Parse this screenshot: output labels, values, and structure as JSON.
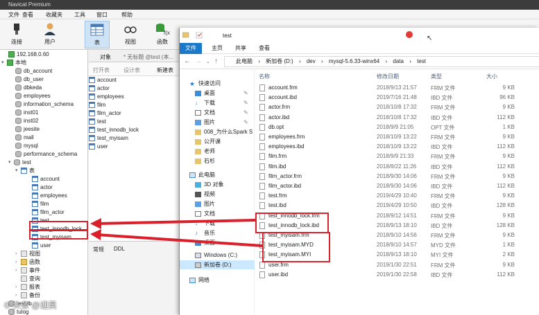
{
  "navicat": {
    "title": "Navicat Premium",
    "menu": [
      "文件",
      "查看",
      "收藏夹",
      "工具",
      "窗口",
      "帮助"
    ],
    "toolbar": [
      {
        "label": "连接",
        "icon": "plug-icon"
      },
      {
        "label": "用户",
        "icon": "user-icon"
      },
      {
        "label": "表",
        "icon": "table-icon"
      },
      {
        "label": "视图",
        "icon": "view-icon"
      },
      {
        "label": "函数",
        "icon": "function-icon"
      }
    ],
    "tree": {
      "server": "192.168.0.60",
      "local": "本地",
      "databases": [
        "db_account",
        "db_user",
        "dbkeda",
        "employees",
        "information_schema",
        "inst01",
        "inst02",
        "jeesite",
        "mall",
        "mysql",
        "performance_schema"
      ],
      "test_db": "test",
      "tables_node": "表",
      "tables": [
        "account",
        "actor",
        "employees",
        "film",
        "film_actor",
        "test",
        "test_innodb_lock",
        "test_myisam",
        "user"
      ],
      "other_nodes": [
        "视图",
        "函数",
        "事件",
        "查询",
        "报表",
        "备份"
      ],
      "after": [
        "testdb",
        "tulog"
      ]
    },
    "middle": {
      "tab_object": "对象",
      "tab_untitled": "* 无标题 @test (本...",
      "tool_open": "打开表",
      "tool_design": "设计表",
      "tool_new": "新建表",
      "tables": [
        "account",
        "actor",
        "employees",
        "film",
        "film_actor",
        "test",
        "test_innodb_lock",
        "test_myisam",
        "user"
      ],
      "lower_tabs": [
        "常规",
        "DDL"
      ]
    }
  },
  "explorer": {
    "title": "test",
    "ribbon": [
      "文件",
      "主页",
      "共享",
      "查看"
    ],
    "path": [
      "此电脑",
      "新加卷 (D:)",
      "dev",
      "mysql-5.6.33-winx64",
      "data",
      "test"
    ],
    "nav": [
      {
        "label": "快速访问",
        "icon": "star-icon"
      },
      {
        "label": "桌面",
        "icon": "desktop-icon"
      },
      {
        "label": "下载",
        "icon": "download-icon"
      },
      {
        "label": "文档",
        "icon": "document-icon"
      },
      {
        "label": "图片",
        "icon": "picture-icon"
      },
      {
        "label": "008_为什么Spark S",
        "icon": "folder-icon"
      },
      {
        "label": "公开课",
        "icon": "folder-icon"
      },
      {
        "label": "老师",
        "icon": "folder-icon"
      },
      {
        "label": "石杉",
        "icon": "folder-icon"
      },
      {
        "label": "此电脑",
        "icon": "computer-icon"
      },
      {
        "label": "3D 对象",
        "icon": "cube-icon"
      },
      {
        "label": "视频",
        "icon": "video-icon"
      },
      {
        "label": "图片",
        "icon": "picture-icon"
      },
      {
        "label": "文档",
        "icon": "document-icon"
      },
      {
        "label": "下载",
        "icon": "download-icon"
      },
      {
        "label": "音乐",
        "icon": "music-icon"
      },
      {
        "label": "桌面",
        "icon": "desktop-icon"
      },
      {
        "label": "Windows (C:)",
        "icon": "drive-icon"
      },
      {
        "label": "新加卷 (D:)",
        "icon": "drive-icon"
      },
      {
        "label": "网络",
        "icon": "network-icon"
      }
    ],
    "columns": {
      "name": "名称",
      "date": "修改日期",
      "type": "类型",
      "size": "大小"
    },
    "files": [
      {
        "name": "account.frm",
        "date": "2018/9/13 21:57",
        "type": "FRM 文件",
        "size": "9 KB"
      },
      {
        "name": "account.ibd",
        "date": "2019/7/16 21:48",
        "type": "IBD 文件",
        "size": "96 KB"
      },
      {
        "name": "actor.frm",
        "date": "2018/10/8 17:32",
        "type": "FRM 文件",
        "size": "9 KB"
      },
      {
        "name": "actor.ibd",
        "date": "2018/10/8 17:32",
        "type": "IBD 文件",
        "size": "112 KB"
      },
      {
        "name": "db.opt",
        "date": "2018/9/9 21:05",
        "type": "OPT 文件",
        "size": "1 KB"
      },
      {
        "name": "employees.frm",
        "date": "2018/10/9 13:22",
        "type": "FRM 文件",
        "size": "9 KB"
      },
      {
        "name": "employees.ibd",
        "date": "2018/10/9 13:22",
        "type": "IBD 文件",
        "size": "112 KB"
      },
      {
        "name": "film.frm",
        "date": "2018/9/9 21:33",
        "type": "FRM 文件",
        "size": "9 KB"
      },
      {
        "name": "film.ibd",
        "date": "2018/8/22 11:26",
        "type": "IBD 文件",
        "size": "112 KB"
      },
      {
        "name": "film_actor.frm",
        "date": "2018/9/30 14:06",
        "type": "FRM 文件",
        "size": "9 KB"
      },
      {
        "name": "film_actor.ibd",
        "date": "2018/9/30 14:06",
        "type": "IBD 文件",
        "size": "112 KB"
      },
      {
        "name": "test.frm",
        "date": "2019/4/29 10:40",
        "type": "FRM 文件",
        "size": "9 KB"
      },
      {
        "name": "test.ibd",
        "date": "2019/4/29 10:50",
        "type": "IBD 文件",
        "size": "128 KB"
      },
      {
        "name": "test_innodb_lock.frm",
        "date": "2018/9/12 14:51",
        "type": "FRM 文件",
        "size": "9 KB"
      },
      {
        "name": "test_innodb_lock.ibd",
        "date": "2018/9/13 18:10",
        "type": "IBD 文件",
        "size": "128 KB"
      },
      {
        "name": "test_myisam.frm",
        "date": "2018/9/10 14:56",
        "type": "FRM 文件",
        "size": "9 KB"
      },
      {
        "name": "test_myisam.MYD",
        "date": "2018/9/10 14:57",
        "type": "MYD 文件",
        "size": "1 KB"
      },
      {
        "name": "test_myisam.MYI",
        "date": "2018/9/13 18:10",
        "type": "MYI 文件",
        "size": "2 KB"
      },
      {
        "name": "user.frm",
        "date": "2019/1/30 22:51",
        "type": "FRM 文件",
        "size": "9 KB"
      },
      {
        "name": "user.ibd",
        "date": "2019/1/30 22:58",
        "type": "IBD 文件",
        "size": "112 KB"
      }
    ]
  },
  "watermark": "© 头条 @迎昊",
  "colors": {
    "highlight": "#d9202b",
    "ribbon_file": "#1979ca"
  }
}
